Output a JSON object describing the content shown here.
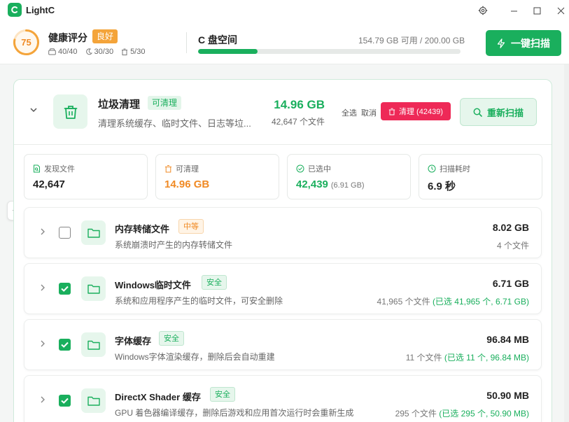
{
  "app": {
    "title": "LightC"
  },
  "header": {
    "score": "75",
    "health_title": "健康评分",
    "health_badge": "良好",
    "stats": [
      {
        "icon": "disk-icon",
        "value": "40/40"
      },
      {
        "icon": "moon-icon",
        "value": "30/30"
      },
      {
        "icon": "trash-icon",
        "value": "5/30"
      }
    ],
    "disk_title": "C 盘空间",
    "disk_info": "154.79 GB 可用 / 200.00 GB",
    "disk_used_fraction": 0.226,
    "oneclick_label": "一键扫描"
  },
  "junk": {
    "title": "垃圾清理",
    "badge": "可清理",
    "desc": "清理系统缓存、临时文件、日志等垃...",
    "size": "14.96 GB",
    "count": "42,647 个文件",
    "select_all": "全选",
    "cancel": "取消",
    "clean_label": "清理 (42439)",
    "rescan_label": "重新扫描"
  },
  "stats": [
    {
      "icon": "file-found-icon",
      "label": "发现文件",
      "value": "42,647",
      "sub": "",
      "color": "#222222"
    },
    {
      "icon": "trash-icon",
      "label": "可清理",
      "value": "14.96 GB",
      "sub": "",
      "color": "#f08a24"
    },
    {
      "icon": "check-circle-icon",
      "label": "已选中",
      "value": "42,439",
      "sub": "(6.91 GB)",
      "color": "#1aaf5d"
    },
    {
      "icon": "clock-icon",
      "label": "扫描耗时",
      "value": "6.9 秒",
      "sub": "",
      "color": "#222222"
    }
  ],
  "items": [
    {
      "title": "内存转储文件",
      "badge": "中等",
      "level": "mid",
      "checked": false,
      "desc": "系统崩溃时产生的内存转储文件",
      "size": "8.02 GB",
      "count": "4 个文件",
      "selected": ""
    },
    {
      "title": "Windows临时文件",
      "badge": "安全",
      "level": "safe",
      "checked": true,
      "desc": "系统和应用程序产生的临时文件，可安全删除",
      "size": "6.71 GB",
      "count": "41,965 个文件",
      "selected": "(已选 41,965 个, 6.71 GB)"
    },
    {
      "title": "字体缓存",
      "badge": "安全",
      "level": "safe",
      "checked": true,
      "desc": "Windows字体渲染缓存，删除后会自动重建",
      "size": "96.84 MB",
      "count": "11 个文件",
      "selected": "(已选 11 个, 96.84 MB)"
    },
    {
      "title": "DirectX Shader 缓存",
      "badge": "安全",
      "level": "safe",
      "checked": true,
      "desc": "GPU 着色器编译缓存，删除后游戏和应用首次运行时会重新生成",
      "size": "50.90 MB",
      "count": "295 个文件",
      "selected": "(已选 295 个, 50.90 MB)"
    }
  ],
  "colors": {
    "accent": "#1aaf5d",
    "danger": "#ee2957",
    "warn": "#f4a43a"
  }
}
